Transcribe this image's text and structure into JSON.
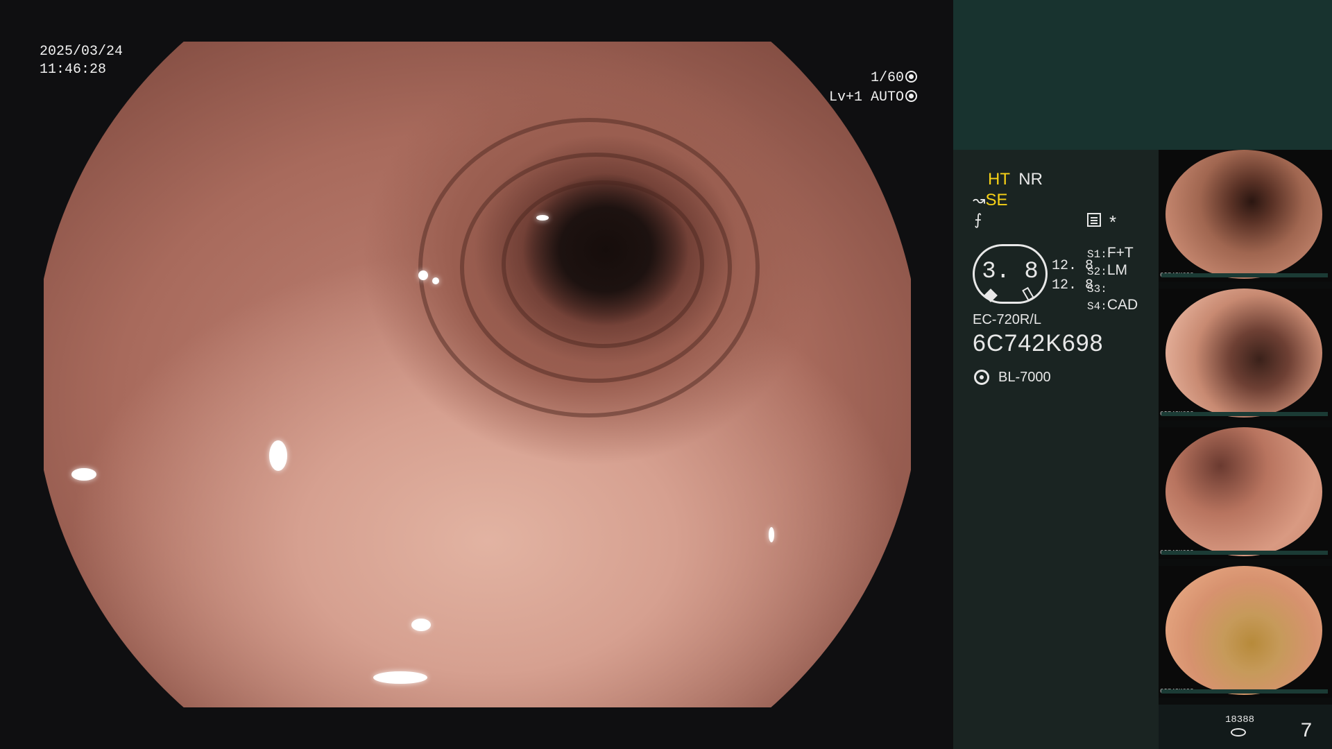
{
  "main": {
    "date": "2025/03/24",
    "time": "11:46:28",
    "shutter": "1/60",
    "level_mode": "Lv+1 AUTO"
  },
  "panel": {
    "ht": "HT",
    "nr": "NR",
    "se": "SE",
    "asterisk": "*",
    "gauge_value": "3. 8",
    "value_a": "12. 8",
    "value_b": "12. 8",
    "s1_label": "S1:",
    "s1_value": "F+T",
    "s2_label": "S2:",
    "s2_value": "LM",
    "s3_label": "S3:",
    "s3_value": "",
    "s4_label": "S4:",
    "s4_value": "CAD",
    "scope_model": "EC-720R/L",
    "serial": "6C742K698",
    "light_source": "BL-7000",
    "counter": "18388",
    "page_number": "7"
  },
  "thumbnails": [
    {
      "tag": "6C742K698"
    },
    {
      "tag": "6C742K698"
    },
    {
      "tag": "6C742K698"
    },
    {
      "tag": "6C742K698"
    }
  ]
}
